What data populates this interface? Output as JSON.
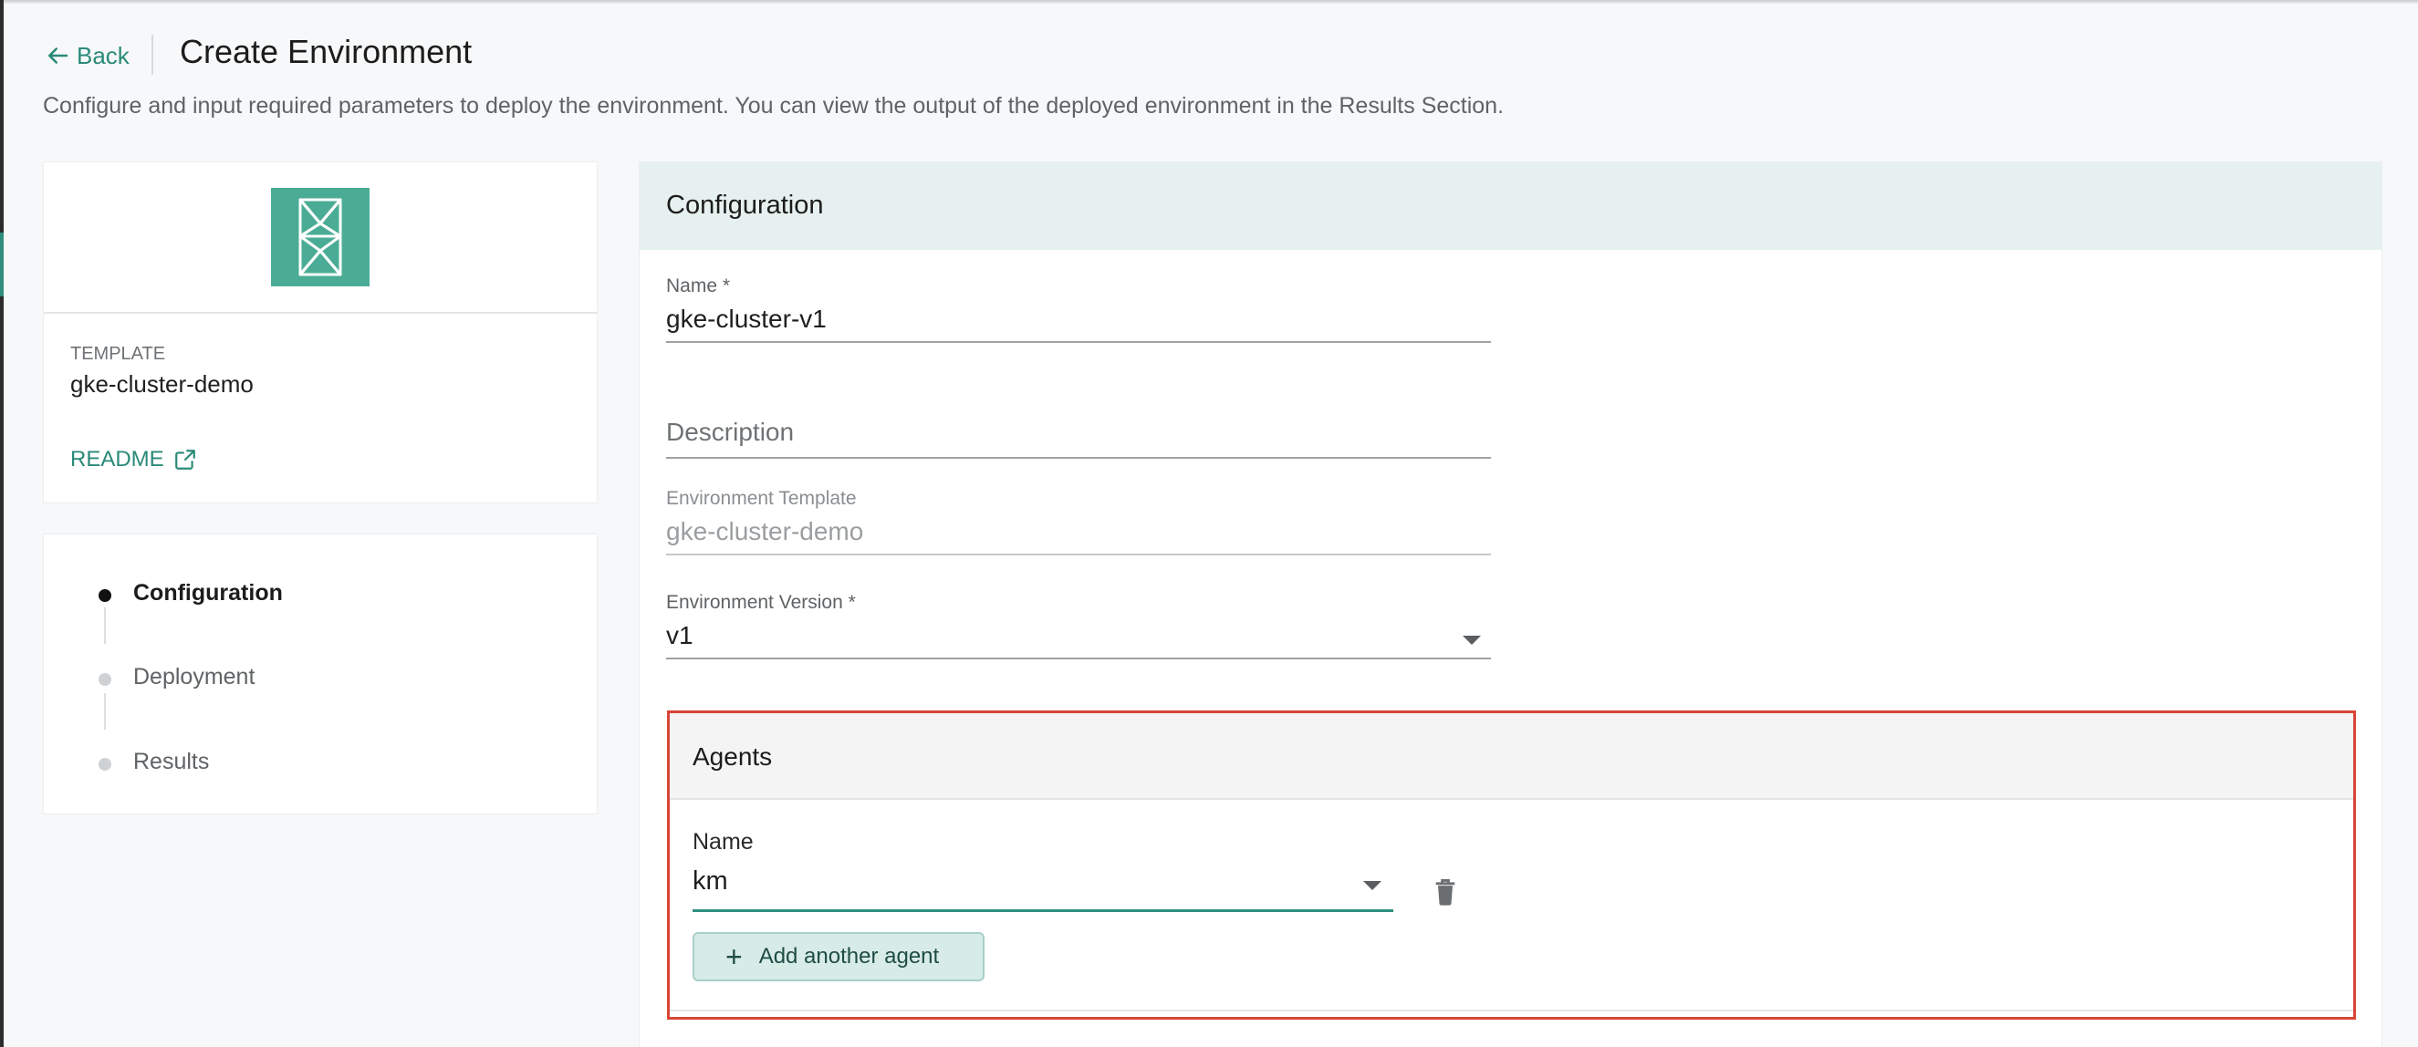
{
  "header": {
    "back_label": "Back",
    "title": "Create Environment",
    "subtitle": "Configure and input required parameters to deploy the environment. You can view the output of the deployed environment in the Results Section."
  },
  "template_card": {
    "label": "TEMPLATE",
    "name": "gke-cluster-demo",
    "readme_label": "README",
    "logo_color": "#4bac96"
  },
  "steps": [
    {
      "label": "Configuration",
      "active": true
    },
    {
      "label": "Deployment",
      "active": false
    },
    {
      "label": "Results",
      "active": false
    }
  ],
  "configuration": {
    "title": "Configuration",
    "name_label": "Name *",
    "name_value": "gke-cluster-v1",
    "description_placeholder": "Description",
    "env_template_label": "Environment Template",
    "env_template_value": "gke-cluster-demo",
    "env_version_label": "Environment Version *",
    "env_version_value": "v1"
  },
  "agents": {
    "title": "Agents",
    "name_label": "Name",
    "name_value": "km",
    "add_button_label": "Add another agent"
  },
  "colors": {
    "accent": "#2a8a78",
    "highlight_border": "#d84536",
    "config_header_bg": "#e6f1ef"
  }
}
